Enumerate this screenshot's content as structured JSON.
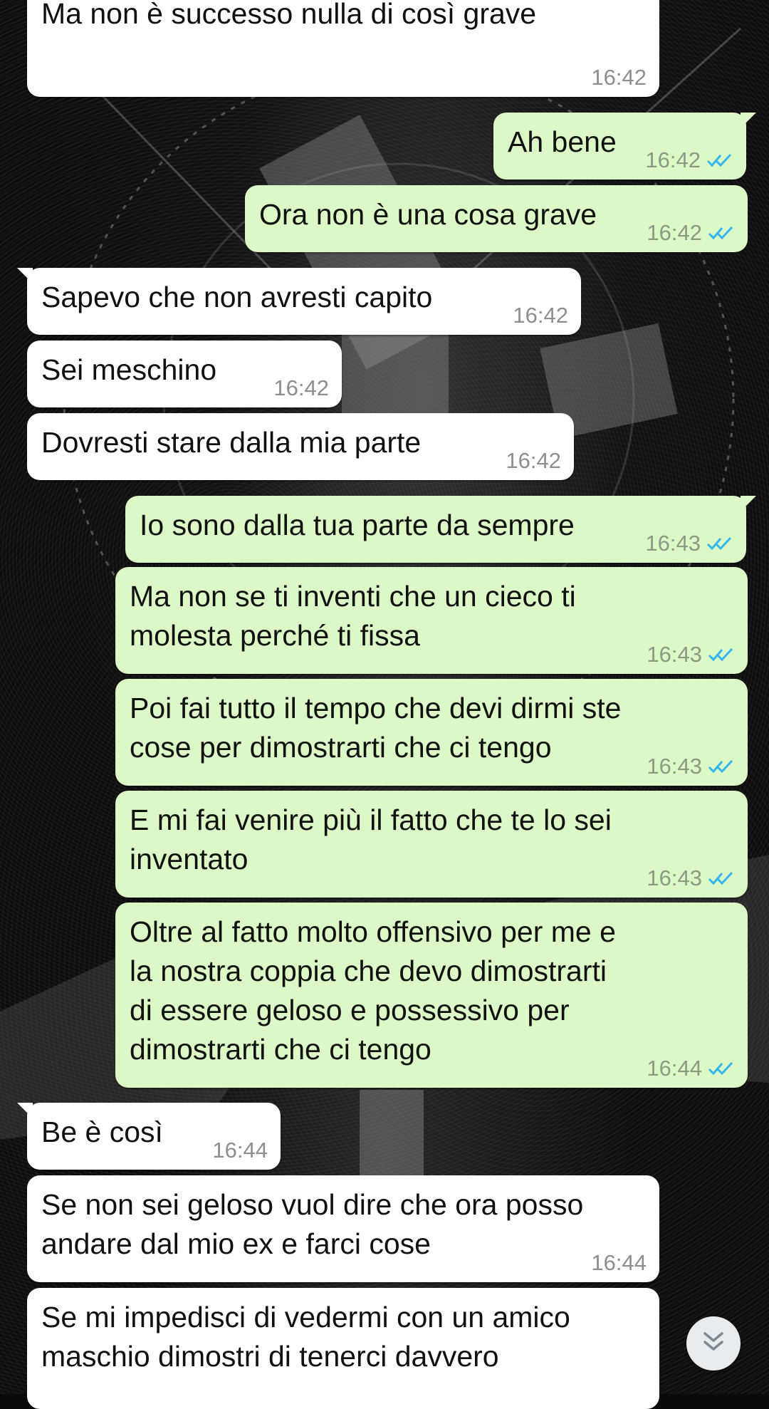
{
  "messages": [
    {
      "id": "m1",
      "direction": "incoming",
      "text": "Ma non è successo nulla di così grave",
      "time": "16:42"
    },
    {
      "id": "m2",
      "direction": "outgoing",
      "text": "Ah bene",
      "time": "16:42",
      "status": "read"
    },
    {
      "id": "m3",
      "direction": "outgoing",
      "text": "Ora non è una cosa grave",
      "time": "16:42",
      "status": "read"
    },
    {
      "id": "m4",
      "direction": "incoming",
      "text": "Sapevo che non avresti capito",
      "time": "16:42"
    },
    {
      "id": "m5",
      "direction": "incoming",
      "text": "Sei meschino",
      "time": "16:42"
    },
    {
      "id": "m6",
      "direction": "incoming",
      "text": "Dovresti stare dalla mia parte",
      "time": "16:42"
    },
    {
      "id": "m7",
      "direction": "outgoing",
      "text": "Io sono dalla tua parte da sempre",
      "time": "16:43",
      "status": "read"
    },
    {
      "id": "m8",
      "direction": "outgoing",
      "text": "Ma non se ti inventi che un cieco ti\nmolesta perché ti fissa",
      "time": "16:43",
      "status": "read"
    },
    {
      "id": "m9",
      "direction": "outgoing",
      "text": "Poi fai tutto il tempo che devi dirmi ste\ncose per dimostrarti che ci tengo",
      "time": "16:43",
      "status": "read"
    },
    {
      "id": "m10",
      "direction": "outgoing",
      "text": "E mi fai venire più il fatto che te lo sei\ninventato",
      "time": "16:43",
      "status": "read"
    },
    {
      "id": "m11",
      "direction": "outgoing",
      "text": "Oltre al fatto molto offensivo per me e\nla nostra coppia che devo dimostrarti\ndi essere geloso e possessivo per\ndimostrarti che ci tengo",
      "time": "16:44",
      "status": "read"
    },
    {
      "id": "m12",
      "direction": "incoming",
      "text": "Be è così",
      "time": "16:44"
    },
    {
      "id": "m13",
      "direction": "incoming",
      "text": "Se non sei geloso vuol dire che ora posso\nandare dal mio ex e farci cose",
      "time": "16:44"
    },
    {
      "id": "m14",
      "direction": "incoming",
      "text": "Se mi impedisci di vedermi con un amico\nmaschio dimostri di tenerci davvero",
      "time": ""
    }
  ],
  "colors": {
    "incoming_bubble": "#ffffff",
    "outgoing_bubble": "#dcf8c6",
    "read_ticks": "#34b7f1",
    "timestamp": "#8e8e8e"
  },
  "scroll_button": {
    "icon": "double-chevron-down-icon"
  }
}
